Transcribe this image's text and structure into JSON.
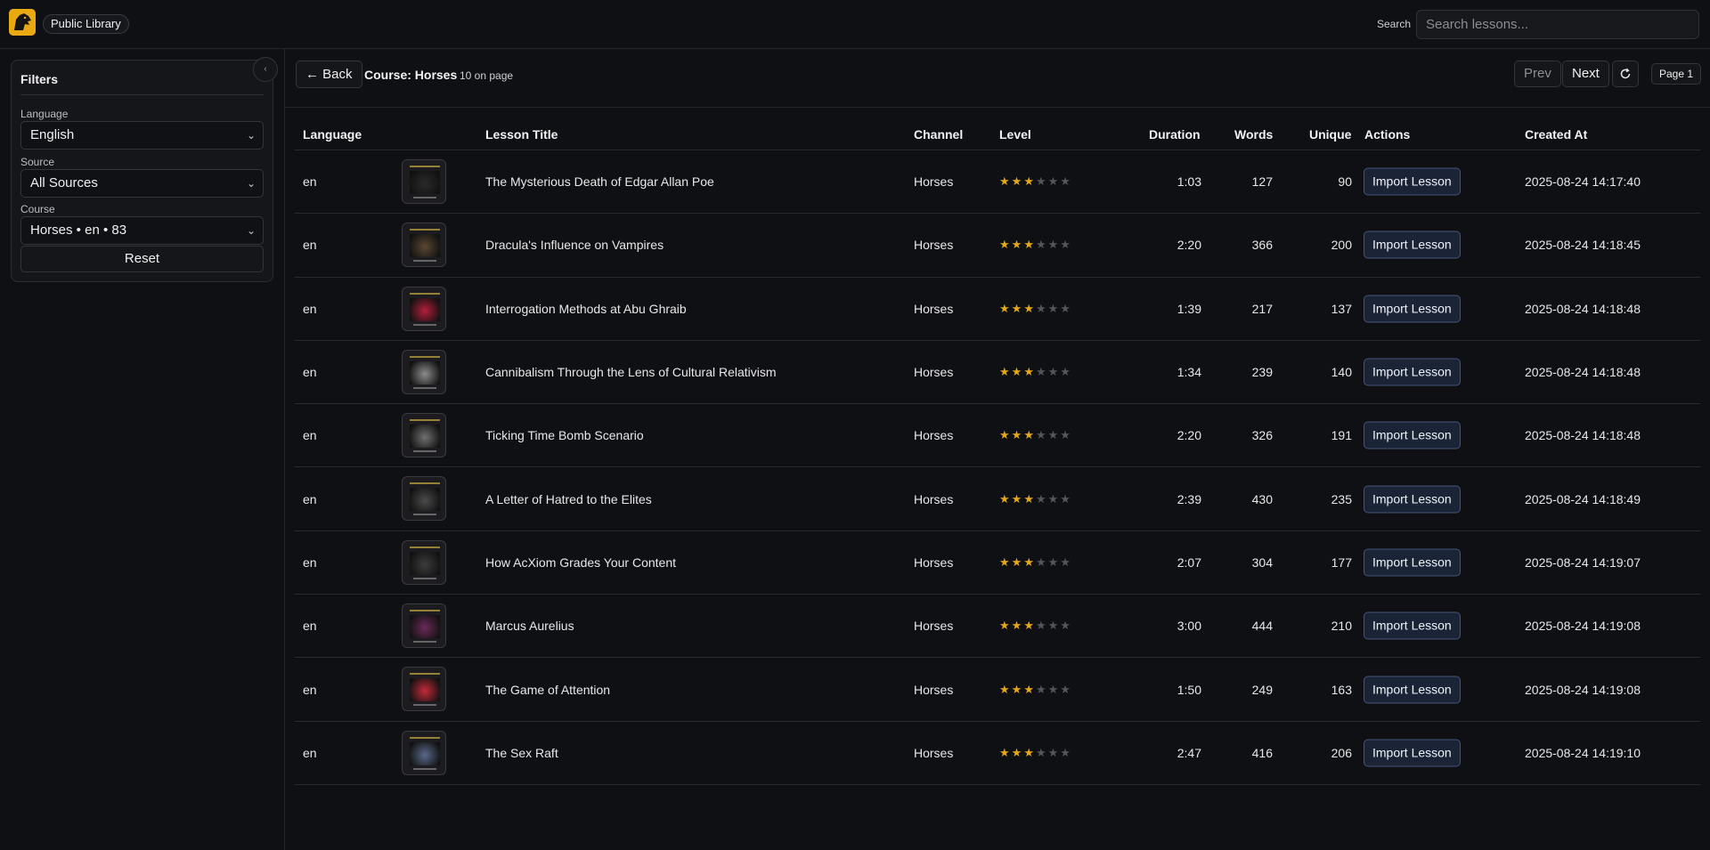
{
  "header": {
    "brand_label": "Public Library",
    "search_label": "Search",
    "search_placeholder": "Search lessons..."
  },
  "filters": {
    "title": "Filters",
    "language_label": "Language",
    "language_value": "English",
    "source_label": "Source",
    "source_value": "All Sources",
    "course_label": "Course",
    "course_value": "Horses • en • 83",
    "reset_label": "Reset"
  },
  "main_header": {
    "back_label": "← Back",
    "course_title": "Course: Horses",
    "count_label": "10 on page",
    "prev_label": "Prev",
    "next_label": "Next",
    "page_label": "Page 1"
  },
  "table": {
    "columns": {
      "language": "Language",
      "title": "Lesson Title",
      "channel": "Channel",
      "level": "Level",
      "duration": "Duration",
      "words": "Words",
      "unique": "Unique",
      "actions": "Actions",
      "created": "Created At"
    },
    "rows": [
      {
        "lang": "en",
        "title": "The Mysterious Death of Edgar Allan Poe",
        "channel": "Horses",
        "level": 3,
        "duration": "1:03",
        "words": "127",
        "unique": "90",
        "action": "Import Lesson",
        "created": "2025-08-24 14:17:40",
        "thumb": "#2a2a2a"
      },
      {
        "lang": "en",
        "title": "Dracula's Influence on Vampires",
        "channel": "Horses",
        "level": 3,
        "duration": "2:20",
        "words": "366",
        "unique": "200",
        "action": "Import Lesson",
        "created": "2025-08-24 14:18:45",
        "thumb": "#5a4632"
      },
      {
        "lang": "en",
        "title": "Interrogation Methods at Abu Ghraib",
        "channel": "Horses",
        "level": 3,
        "duration": "1:39",
        "words": "217",
        "unique": "137",
        "action": "Import Lesson",
        "created": "2025-08-24 14:18:48",
        "thumb": "#b31e3a"
      },
      {
        "lang": "en",
        "title": "Cannibalism Through the Lens of Cultural Relativism",
        "channel": "Horses",
        "level": 3,
        "duration": "1:34",
        "words": "239",
        "unique": "140",
        "action": "Import Lesson",
        "created": "2025-08-24 14:18:48",
        "thumb": "#8c8c8c"
      },
      {
        "lang": "en",
        "title": "Ticking Time Bomb Scenario",
        "channel": "Horses",
        "level": 3,
        "duration": "2:20",
        "words": "326",
        "unique": "191",
        "action": "Import Lesson",
        "created": "2025-08-24 14:18:48",
        "thumb": "#707070"
      },
      {
        "lang": "en",
        "title": "A Letter of Hatred to the Elites",
        "channel": "Horses",
        "level": 3,
        "duration": "2:39",
        "words": "430",
        "unique": "235",
        "action": "Import Lesson",
        "created": "2025-08-24 14:18:49",
        "thumb": "#4a4a4a"
      },
      {
        "lang": "en",
        "title": "How AcXiom Grades Your Content",
        "channel": "Horses",
        "level": 3,
        "duration": "2:07",
        "words": "304",
        "unique": "177",
        "action": "Import Lesson",
        "created": "2025-08-24 14:19:07",
        "thumb": "#3c3c3c"
      },
      {
        "lang": "en",
        "title": "Marcus Aurelius",
        "channel": "Horses",
        "level": 3,
        "duration": "3:00",
        "words": "444",
        "unique": "210",
        "action": "Import Lesson",
        "created": "2025-08-24 14:19:08",
        "thumb": "#6a2a58"
      },
      {
        "lang": "en",
        "title": "The Game of Attention",
        "channel": "Horses",
        "level": 3,
        "duration": "1:50",
        "words": "249",
        "unique": "163",
        "action": "Import Lesson",
        "created": "2025-08-24 14:19:08",
        "thumb": "#c42a3a"
      },
      {
        "lang": "en",
        "title": "The Sex Raft",
        "channel": "Horses",
        "level": 3,
        "duration": "2:47",
        "words": "416",
        "unique": "206",
        "action": "Import Lesson",
        "created": "2025-08-24 14:19:10",
        "thumb": "#5a6a8a"
      }
    ],
    "max_level": 6
  }
}
